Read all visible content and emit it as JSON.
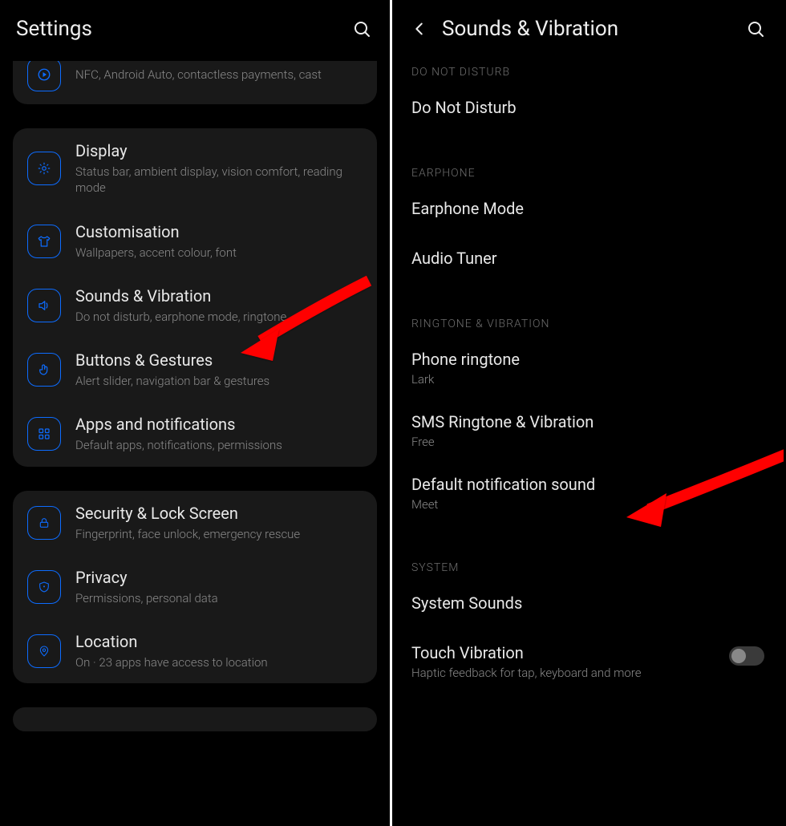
{
  "left": {
    "header_title": "Settings",
    "card1": {
      "partial_sub": "NFC, Android Auto, contactless payments, cast"
    },
    "card2": {
      "display": {
        "title": "Display",
        "sub": "Status bar, ambient display, vision comfort, reading mode"
      },
      "custom": {
        "title": "Customisation",
        "sub": "Wallpapers, accent colour, font"
      },
      "sounds": {
        "title": "Sounds & Vibration",
        "sub": "Do not disturb, earphone mode, ringtone"
      },
      "buttons": {
        "title": "Buttons & Gestures",
        "sub": "Alert slider, navigation bar & gestures"
      },
      "apps": {
        "title": "Apps and notifications",
        "sub": "Default apps, notifications, permissions"
      }
    },
    "card3": {
      "security": {
        "title": "Security & Lock Screen",
        "sub": "Fingerprint, face unlock, emergency rescue"
      },
      "privacy": {
        "title": "Privacy",
        "sub": "Permissions, personal data"
      },
      "location": {
        "title": "Location",
        "sub": "On · 23 apps have access to location"
      }
    }
  },
  "right": {
    "header_title": "Sounds & Vibration",
    "sections": {
      "dnd": {
        "header": "Do Not Disturb",
        "item": "Do Not Disturb"
      },
      "earphone": {
        "header": "Earphone",
        "mode": "Earphone Mode",
        "tuner": "Audio Tuner"
      },
      "ringtone": {
        "header": "Ringtone & Vibration",
        "phone": {
          "title": "Phone ringtone",
          "sub": "Lark"
        },
        "sms": {
          "title": "SMS Ringtone & Vibration",
          "sub": "Free"
        },
        "notif": {
          "title": "Default notification sound",
          "sub": "Meet"
        }
      },
      "system": {
        "header": "System",
        "sounds": "System Sounds",
        "touch": {
          "title": "Touch Vibration",
          "sub": "Haptic feedback for tap, keyboard and more"
        }
      }
    }
  }
}
